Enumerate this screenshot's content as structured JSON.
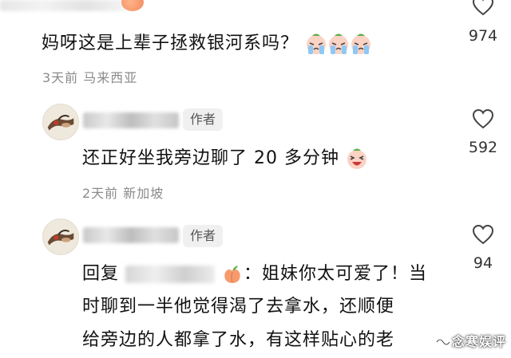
{
  "comments": [
    {
      "text": "妈呀这是上辈子拯救银河系吗？",
      "emojis": [
        "crying-face",
        "crying-face",
        "crying-face"
      ],
      "meta": "3天前  马来西亚",
      "likes": "974"
    },
    {
      "author_tag": "作者",
      "text": "还正好坐我旁边聊了 20 多分钟",
      "emojis": [
        "laughing-face"
      ],
      "meta": "2天前  新加坡",
      "likes": "592"
    },
    {
      "author_tag": "作者",
      "reply_prefix": "回复",
      "line1_rest": "：姐妹你太可爱了！当",
      "line2": "时聊到一半他觉得渴了去拿水，还顺便",
      "line3": "给旁边的人都拿了水，有这样贴心的老",
      "likes": "94"
    }
  ],
  "watermark": "念寒娱评",
  "colors": {
    "meta_gray": "#8a8a8a",
    "tag_bg": "#f0f0f0"
  }
}
